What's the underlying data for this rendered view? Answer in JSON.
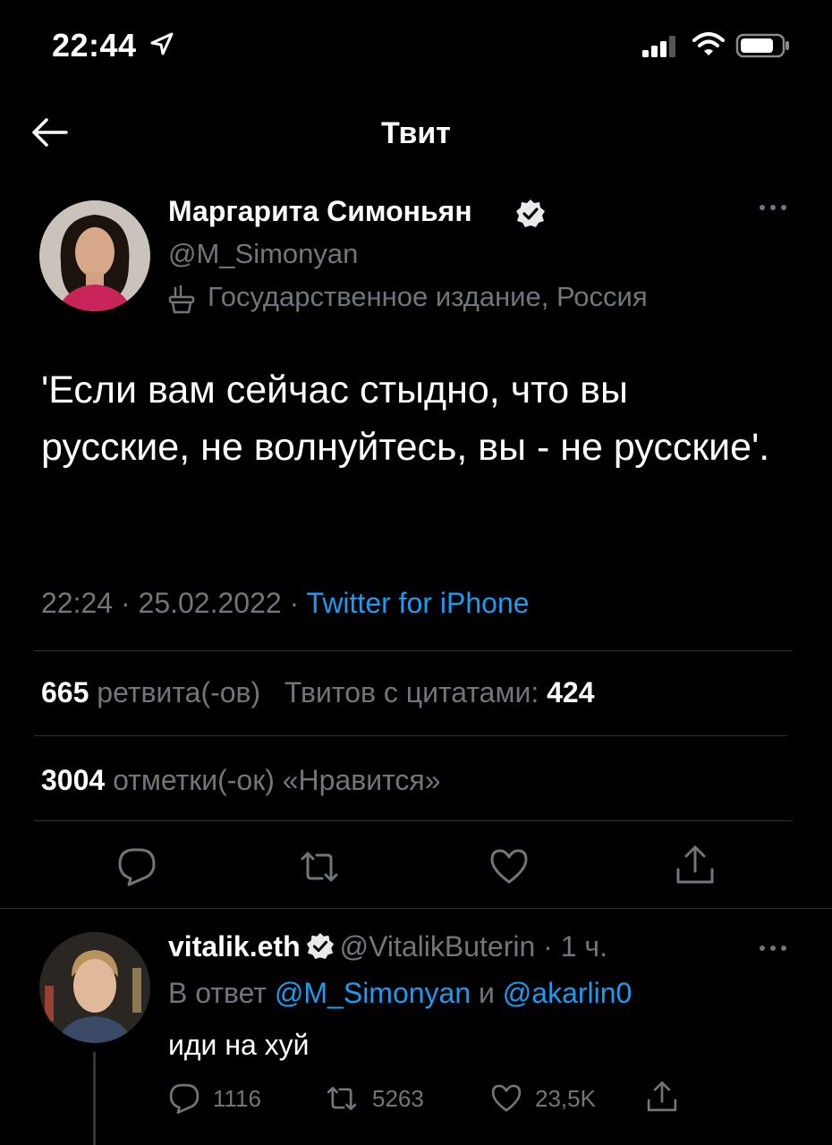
{
  "status_bar": {
    "time": "22:44"
  },
  "nav": {
    "title": "Твит"
  },
  "tweet": {
    "author_name": "Маргарита Симоньян",
    "handle": "@M_Simonyan",
    "label": "Государственное издание, Россия",
    "text": "'Если вам сейчас стыдно, что вы русские, не волнуйтесь, вы - не русские'.",
    "time": "22:24",
    "date": "25.02.2022",
    "source": "Twitter for iPhone",
    "retweets_count": "665",
    "retweets_label": "ретвита(-ов)",
    "quotes_label": "Твитов с цитатами:",
    "quotes_count": "424",
    "likes_count": "3004",
    "likes_label": "отметки(-ок) «Нравится»"
  },
  "reply": {
    "author_name": "vitalik.eth",
    "handle": "@VitalikButerin",
    "time_ago": "1 ч.",
    "in_reply_prefix": "В ответ",
    "mention_1": "@M_Simonyan",
    "conjunction": "и",
    "mention_2": "@akarlin0",
    "text": "иди на хуй",
    "reply_count": "1116",
    "retweet_count": "5263",
    "like_count": "23,5K"
  },
  "colors": {
    "background": "#000000",
    "text_primary": "#e7e9ea",
    "text_secondary": "#71767b",
    "accent": "#1d9bf0",
    "divider": "#2f3336"
  },
  "icons": [
    "location-arrow-icon",
    "signal-icon",
    "wifi-icon",
    "battery-icon",
    "back-arrow-icon",
    "verified-badge-icon",
    "state-media-icon",
    "more-options-icon",
    "reply-icon",
    "retweet-icon",
    "like-icon",
    "share-icon"
  ]
}
